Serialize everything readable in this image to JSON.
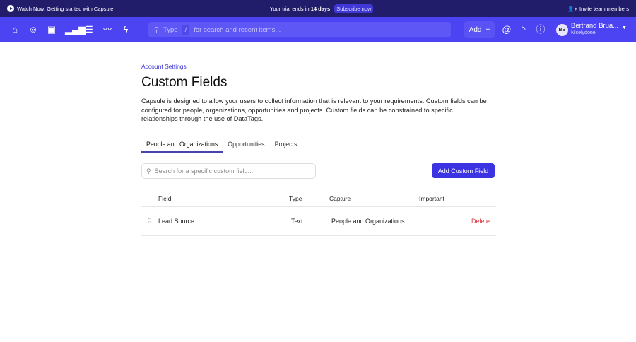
{
  "topbar": {
    "watch": "Watch Now: Getting started with Capsule",
    "trial_prefix": "Your trial ends in",
    "trial_days": "14 days",
    "subscribe": "Subscribe now",
    "invite": "Invite team members"
  },
  "nav": {
    "search_type": "Type",
    "search_slash": "/",
    "search_placeholder": "for search and recent items...",
    "add": "Add",
    "user_initials": "BB",
    "user_name": "Bertrand Brua...",
    "user_org": "Nicelydone"
  },
  "page": {
    "breadcrumb": "Account Settings",
    "title": "Custom Fields",
    "description": "Capsule is designed to allow your users to collect information that is relevant to your requirements. Custom fields can be configured for people, organizations, opportunities and projects. Custom fields can be constrained to specific relationships through the use of DataTags.",
    "tabs": [
      {
        "label": "People and Organizations"
      },
      {
        "label": "Opportunities"
      },
      {
        "label": "Projects"
      }
    ],
    "search_placeholder": "Search for a specific custom field...",
    "add_button": "Add Custom Field",
    "columns": [
      "Field",
      "Type",
      "Capture",
      "Important"
    ],
    "rows": [
      {
        "field": "Lead Source",
        "type": "Text",
        "capture": "People and Organizations",
        "action": "Delete"
      }
    ]
  }
}
